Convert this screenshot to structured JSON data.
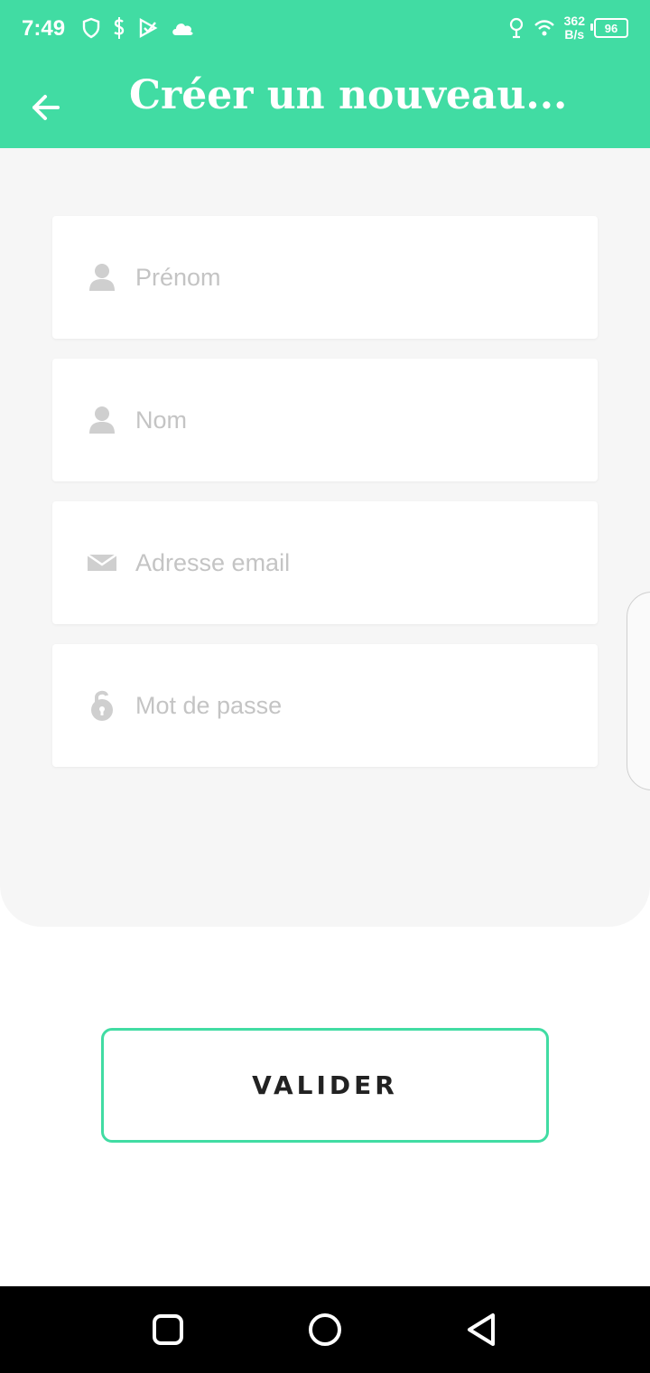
{
  "status_bar": {
    "time": "7:49",
    "netspeed_value": "362",
    "netspeed_unit": "B/s",
    "battery": "96",
    "icons": [
      "shield-icon",
      "dollar-icon",
      "play-store-icon",
      "cloud-icon",
      "location-pin-icon",
      "wifi-icon",
      "battery-icon"
    ]
  },
  "app_bar": {
    "title": "Créer un nouveau...",
    "back_icon": "arrow-left-icon"
  },
  "form": {
    "fields": [
      {
        "placeholder": "Prénom",
        "icon": "person-icon",
        "value": ""
      },
      {
        "placeholder": "Nom",
        "icon": "person-icon",
        "value": ""
      },
      {
        "placeholder": "Adresse email",
        "icon": "envelope-icon",
        "value": ""
      },
      {
        "placeholder": "Mot de passe",
        "icon": "lock-icon",
        "value": ""
      }
    ]
  },
  "validate_button": {
    "label": "VALIDER"
  },
  "colors": {
    "accent": "#41dca3",
    "panel_bg": "#f6f6f6",
    "placeholder": "#c4c4c4"
  },
  "nav_bar": {
    "icons": [
      "square-icon",
      "circle-icon",
      "triangle-back-icon"
    ]
  }
}
